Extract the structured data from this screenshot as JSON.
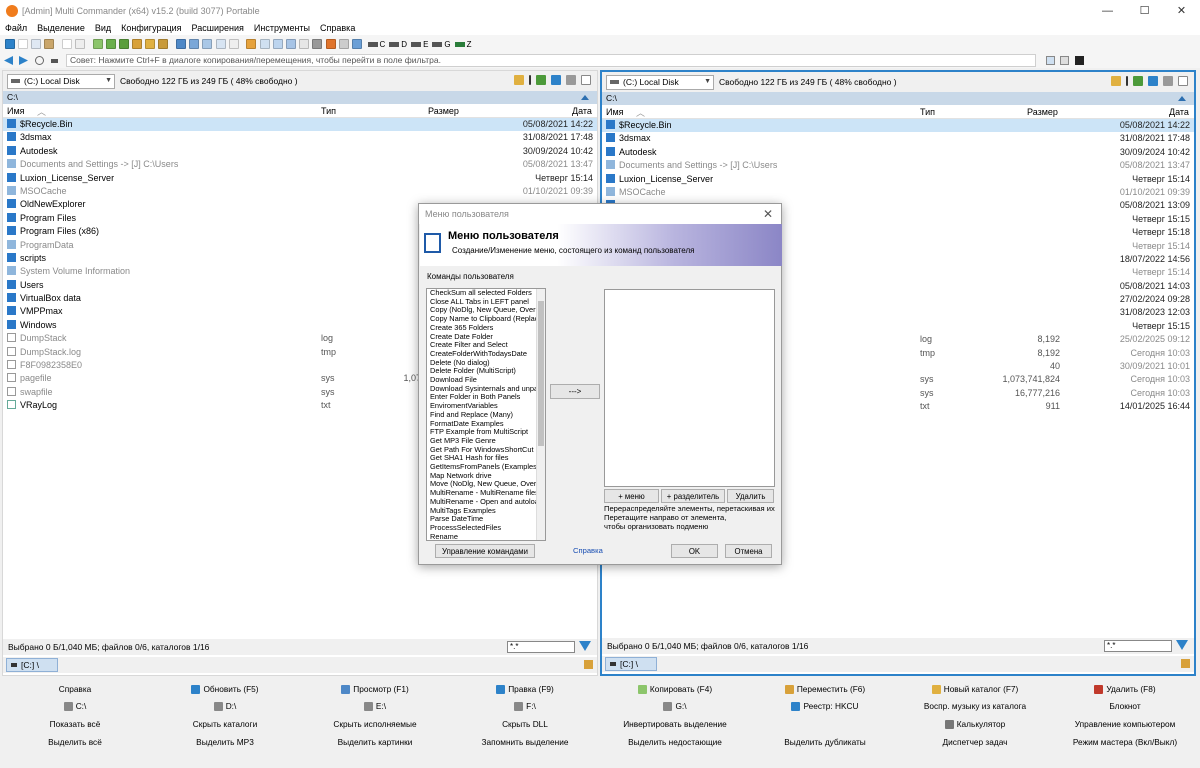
{
  "window": {
    "title": "[Admin] Multi Commander (x64)  v15.2 (build 3077) Portable",
    "controls": [
      "—",
      "☐",
      "✕"
    ]
  },
  "menu": [
    "Файл",
    "Выделение",
    "Вид",
    "Конфигурация",
    "Расширения",
    "Инструменты",
    "Справка"
  ],
  "toolbar": {
    "drives": [
      "C",
      "D",
      "E",
      "G",
      "Z"
    ]
  },
  "hint": "Совет: Нажмите Ctrl+F в диалоге копирования/перемещения, чтобы перейти в поле фильтра.",
  "left_panel": {
    "drive": "(C:) Local Disk",
    "free": "Свободно 122 ГБ из 249 ГБ ( 48% свободно )",
    "path": "C:\\",
    "columns": {
      "name": "Имя",
      "type": "Тип",
      "size": "Размер",
      "date": "Дата"
    },
    "rows": [
      {
        "name": "$Recycle.Bin",
        "type": "",
        "size": "",
        "date": "05/08/2021 14:22",
        "kind": "folder",
        "dim": false
      },
      {
        "name": "3dsmax",
        "type": "",
        "size": "",
        "date": "31/08/2021 17:48",
        "kind": "folder",
        "dim": false
      },
      {
        "name": "Autodesk",
        "type": "",
        "size": "",
        "date": "30/09/2024 10:42",
        "kind": "folder",
        "dim": false
      },
      {
        "name": "Documents and Settings ->  [J] C:\\Users",
        "type": "",
        "size": "",
        "date": "05/08/2021 13:47",
        "kind": "folder",
        "dim": true
      },
      {
        "name": "Luxion_License_Server",
        "type": "",
        "size": "",
        "date": "Четверг 15:14",
        "kind": "folder",
        "dim": false
      },
      {
        "name": "MSOCache",
        "type": "",
        "size": "",
        "date": "01/10/2021 09:39",
        "kind": "folder",
        "dim": true
      },
      {
        "name": "OldNewExplorer",
        "type": "",
        "size": "",
        "date": "",
        "kind": "folder",
        "dim": false
      },
      {
        "name": "Program Files",
        "type": "",
        "size": "",
        "date": "",
        "kind": "folder",
        "dim": false
      },
      {
        "name": "Program Files (x86)",
        "type": "",
        "size": "",
        "date": "",
        "kind": "folder",
        "dim": false
      },
      {
        "name": "ProgramData",
        "type": "",
        "size": "",
        "date": "",
        "kind": "folder",
        "dim": true
      },
      {
        "name": "scripts",
        "type": "",
        "size": "",
        "date": "",
        "kind": "folder",
        "dim": false
      },
      {
        "name": "System Volume Information",
        "type": "",
        "size": "",
        "date": "",
        "kind": "folder",
        "dim": true
      },
      {
        "name": "Users",
        "type": "",
        "size": "",
        "date": "",
        "kind": "folder",
        "dim": false
      },
      {
        "name": "VirtualBox data",
        "type": "",
        "size": "",
        "date": "",
        "kind": "folder",
        "dim": false
      },
      {
        "name": "VMPPmax",
        "type": "",
        "size": "",
        "date": "",
        "kind": "folder",
        "dim": false
      },
      {
        "name": "Windows",
        "type": "",
        "size": "",
        "date": "",
        "kind": "folder",
        "dim": false
      },
      {
        "name": "DumpStack",
        "type": "log",
        "size": "",
        "date": "",
        "kind": "file",
        "dim": true
      },
      {
        "name": "DumpStack.log",
        "type": "tmp",
        "size": "",
        "date": "",
        "kind": "file",
        "dim": true
      },
      {
        "name": "F8F0982358E0",
        "type": "",
        "size": "",
        "date": "",
        "kind": "file",
        "dim": true
      },
      {
        "name": "pagefile",
        "type": "sys",
        "size": "1,07",
        "date": "",
        "kind": "file",
        "dim": true
      },
      {
        "name": "swapfile",
        "type": "sys",
        "size": "",
        "date": "",
        "kind": "file",
        "dim": true
      },
      {
        "name": "VRayLog",
        "type": "txt",
        "size": "",
        "date": "",
        "kind": "vray",
        "dim": false
      }
    ],
    "status": "Выбрано 0 Б/1,040 МБ; файлов 0/6, каталогов 1/16",
    "filter": "*.*",
    "tab": "[C:] \\"
  },
  "right_panel": {
    "drive": "(C:) Local Disk",
    "free": "Свободно 122 ГБ из 249 ГБ ( 48% свободно )",
    "path": "C:\\",
    "columns": {
      "name": "Имя",
      "type": "Тип",
      "size": "Размер",
      "date": "Дата"
    },
    "rows": [
      {
        "name": "$Recycle.Bin",
        "type": "",
        "size": "",
        "date": "05/08/2021 14:22",
        "kind": "folder",
        "dim": false
      },
      {
        "name": "3dsmax",
        "type": "",
        "size": "",
        "date": "31/08/2021 17:48",
        "kind": "folder",
        "dim": false
      },
      {
        "name": "Autodesk",
        "type": "",
        "size": "",
        "date": "30/09/2024 10:42",
        "kind": "folder",
        "dim": false
      },
      {
        "name": "Documents and Settings ->  [J] C:\\Users",
        "type": "",
        "size": "",
        "date": "05/08/2021 13:47",
        "kind": "folder",
        "dim": true
      },
      {
        "name": "Luxion_License_Server",
        "type": "",
        "size": "",
        "date": "Четверг 15:14",
        "kind": "folder",
        "dim": false
      },
      {
        "name": "MSOCache",
        "type": "",
        "size": "",
        "date": "01/10/2021 09:39",
        "kind": "folder",
        "dim": true
      },
      {
        "name": "",
        "type": "",
        "size": "",
        "date": "05/08/2021 13:09",
        "kind": "folder",
        "dim": false
      },
      {
        "name": "",
        "type": "",
        "size": "",
        "date": "Четверг 15:15",
        "kind": "folder",
        "dim": false
      },
      {
        "name": "",
        "type": "",
        "size": "",
        "date": "Четверг 15:18",
        "kind": "folder",
        "dim": false
      },
      {
        "name": "",
        "type": "",
        "size": "",
        "date": "Четверг 15:14",
        "kind": "folder",
        "dim": true
      },
      {
        "name": "",
        "type": "",
        "size": "",
        "date": "18/07/2022 14:56",
        "kind": "folder",
        "dim": false
      },
      {
        "name": "",
        "type": "",
        "size": "",
        "date": "Четверг 15:14",
        "kind": "folder",
        "dim": true
      },
      {
        "name": "",
        "type": "",
        "size": "",
        "date": "05/08/2021 14:03",
        "kind": "folder",
        "dim": false
      },
      {
        "name": "",
        "type": "",
        "size": "",
        "date": "27/02/2024 09:28",
        "kind": "folder",
        "dim": false
      },
      {
        "name": "",
        "type": "",
        "size": "",
        "date": "31/08/2023 12:03",
        "kind": "folder",
        "dim": false
      },
      {
        "name": "",
        "type": "",
        "size": "",
        "date": "Четверг 15:15",
        "kind": "folder",
        "dim": false
      },
      {
        "name": "",
        "type": "log",
        "size": "8,192",
        "date": "25/02/2025 09:12",
        "kind": "file",
        "dim": true
      },
      {
        "name": "",
        "type": "tmp",
        "size": "8,192",
        "date": "Сегодня 10:03",
        "kind": "file",
        "dim": true
      },
      {
        "name": "",
        "type": "",
        "size": "40",
        "date": "30/09/2021 10:01",
        "kind": "file",
        "dim": true
      },
      {
        "name": "",
        "type": "sys",
        "size": "1,073,741,824",
        "date": "Сегодня 10:03",
        "kind": "file",
        "dim": true
      },
      {
        "name": "",
        "type": "sys",
        "size": "16,777,216",
        "date": "Сегодня 10:03",
        "kind": "file",
        "dim": true
      },
      {
        "name": "",
        "type": "txt",
        "size": "911",
        "date": "14/01/2025 16:44",
        "kind": "vray",
        "dim": false
      }
    ],
    "status": "Выбрано 0 Б/1,040 МБ; файлов 0/6, каталогов 1/16",
    "filter": "*.*",
    "tab": "[C:] \\"
  },
  "dialog": {
    "title": "Меню пользователя",
    "header": "Меню пользователя",
    "subtitle": "Создание/Изменение меню, состоящего из команд пользователя",
    "commands_label": "Команды пользователя",
    "commands": [
      "CheckSum all selected Folders",
      "Close ALL Tabs in LEFT panel",
      "Copy (NoDlg, New Queue, Over",
      "Copy Name to Clipboard (Replac",
      "Create 365 Folders",
      "Create Date Folder",
      "Create Filter and Select",
      "CreateFolderWithTodaysDate",
      "Delete (No dialog)",
      "Delete Folder (MultiScript)",
      "Download File",
      "Download Sysinternals and unpa",
      "Enter Folder in Both Panels",
      "EnviromentVariables",
      "Find and Replace (Many)",
      "FormatDate Examples",
      "FTP Example from MultiScript",
      "Get MP3 File Genre",
      "Get Path For WindowsShortCut",
      "Get SHA1 Hash for files",
      "GetItemsFromPanels (Examples)",
      "Map Network drive",
      "Move (NoDlg, New Queue, Over",
      "MultiRename - MultiRename files",
      "MultiRename - Open and autoloa",
      "MultiTags Examples",
      "Parse DateTime",
      "ProcessSelectedFiles",
      "Rename"
    ],
    "move": "--->",
    "add_menu": "+ меню",
    "add_separator": "+ разделитель",
    "delete": "Удалить",
    "hint": "Перераспределяйте элементы, перетаскивая их\nПеретащите направо от элемента,\nчтобы организовать подменю",
    "manage": "Управление командами",
    "help": "Справка",
    "ok": "OK",
    "cancel": "Отмена"
  },
  "fkeys": [
    [
      "Справка",
      "Обновить (F5)",
      "Просмотр (F1)",
      "Правка (F9)",
      "Копировать (F4)",
      "Переместить (F6)",
      "Новый каталог (F7)",
      "Удалить (F8)"
    ],
    [
      "C:\\",
      "D:\\",
      "E:\\",
      "F:\\",
      "G:\\",
      "Реестр: HKCU",
      "Воспр. музыку из каталога",
      "Блокнот"
    ],
    [
      "Показать всё",
      "Скрыть каталоги",
      "Скрыть исполняемые",
      "Скрыть DLL",
      "Инвертировать выделение",
      "",
      "Калькулятор",
      "Управление компьютером"
    ],
    [
      "Выделить всё",
      "Выделить MP3",
      "Выделить картинки",
      "Запомнить выделение",
      "Выделить недостающие",
      "Выделить дубликаты",
      "Диспетчер задач",
      "Режим мастера (Вкл/Выкл)"
    ]
  ],
  "colors": {
    "accent": "#2d82c9",
    "selection": "#cce4f7",
    "folder": "#2a78c8",
    "path_bar": "#c8d8e8"
  }
}
